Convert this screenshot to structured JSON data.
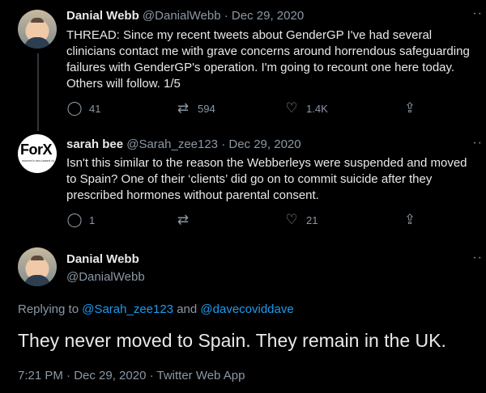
{
  "tweets": [
    {
      "name": "Danial Webb",
      "handle": "@DanialWebb",
      "date": "· Dec 29, 2020",
      "text": "THREAD: Since my recent tweets about GenderGP I've had several clinicians contact me with grave concerns around horrendous safeguarding failures with GenderGP's operation. I'm going to recount one here today. Others will follow. 1/5",
      "replies": "41",
      "retweets": "594",
      "likes": "1.4K"
    },
    {
      "name": "sarah bee",
      "handle": "@Sarah_zee123",
      "date": "· Dec 29, 2020",
      "avatar_text": "ForX",
      "avatar_subtext": "women's sex-based rights and",
      "text": "Isn't this similar to the reason the Webberleys were suspended and moved to Spain? One of their ‘clients’ did go on to commit suicide after they prescribed hormones without parental consent.",
      "replies": "1",
      "retweets": "",
      "likes": "21"
    }
  ],
  "focus": {
    "name": "Danial Webb",
    "handle": "@DanialWebb",
    "replying_prefix": "Replying to",
    "replying_user1": "@Sarah_zee123",
    "replying_and": "and",
    "replying_user2": "@davecoviddave",
    "text": "They never moved to Spain. They remain in the UK.",
    "meta": "7:21 PM · Dec 29, 2020 · Twitter Web App"
  },
  "icons": {
    "reply": "reply-icon",
    "retweet": "retweet-icon",
    "like": "heart-icon",
    "share": "share-icon",
    "more": "more-icon"
  },
  "glyphs": {
    "reply": "◯",
    "retweet": "⇄",
    "like": "♡",
    "share": "⇪",
    "more": "··"
  },
  "colors": {
    "background": "#000000",
    "text": "#e7e9ea",
    "muted": "#8b98a5",
    "link": "#1d9bf0"
  }
}
